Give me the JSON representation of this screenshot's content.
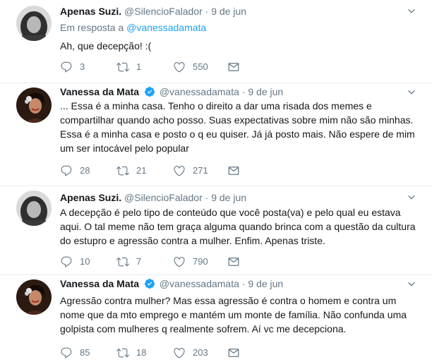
{
  "tweets": [
    {
      "name": "Apenas Suzi.",
      "handle": "@SilencioFalador",
      "dot": "·",
      "date": "9 de jun",
      "verified": false,
      "avatar_icon": "profile-photo-suzi",
      "reply_prefix": "Em resposta a ",
      "reply_mention": "@vanessadamata",
      "text": "Ah, que decepção! :(",
      "replies": "3",
      "retweets": "1",
      "likes": "550"
    },
    {
      "name": "Vanessa da Mata",
      "handle": "@vanessadamata",
      "dot": "·",
      "date": "9 de jun",
      "verified": true,
      "avatar_icon": "profile-photo-vanessa",
      "text": "... Essa é a minha casa. Tenho o direito a dar uma risada dos memes e compartilhar quando acho posso. Suas expectativas sobre mim não são minhas. Essa é a minha casa e posto o q eu quiser. Já já posto mais. Não espere de mim um ser intocável pelo popular",
      "replies": "28",
      "retweets": "21",
      "likes": "271"
    },
    {
      "name": "Apenas Suzi.",
      "handle": "@SilencioFalador",
      "dot": "·",
      "date": "9 de jun",
      "verified": false,
      "avatar_icon": "profile-photo-suzi",
      "text": "A decepção é pelo tipo de conteúdo que você posta(va) e pelo qual eu estava aqui. O tal meme não tem graça alguma quando brinca com a questão da cultura do estupro e agressão contra a mulher. Enfim. Apenas triste.",
      "replies": "10",
      "retweets": "7",
      "likes": "790"
    },
    {
      "name": "Vanessa da Mata",
      "handle": "@vanessadamata",
      "dot": "·",
      "date": "9 de jun",
      "verified": true,
      "avatar_icon": "profile-photo-vanessa",
      "text": "Agressão contra mulher? Mas essa agressão é contra o homem e contra um nome que da mto emprego e mantém um monte de família. Não confunda uma golpista com mulheres q realmente sofrem. Aí vc me decepciona.",
      "replies": "85",
      "retweets": "18",
      "likes": "203"
    }
  ],
  "colors": {
    "text": "#14171a",
    "muted": "#657786",
    "link": "#1da1f2",
    "verified": "#1da1f2",
    "divider": "#e6ecf0"
  },
  "icons": {
    "reply": "reply-icon",
    "retweet": "retweet-icon",
    "like": "heart-icon",
    "dm": "envelope-icon",
    "menu": "chevron-down-icon",
    "verified": "verified-badge-icon"
  }
}
